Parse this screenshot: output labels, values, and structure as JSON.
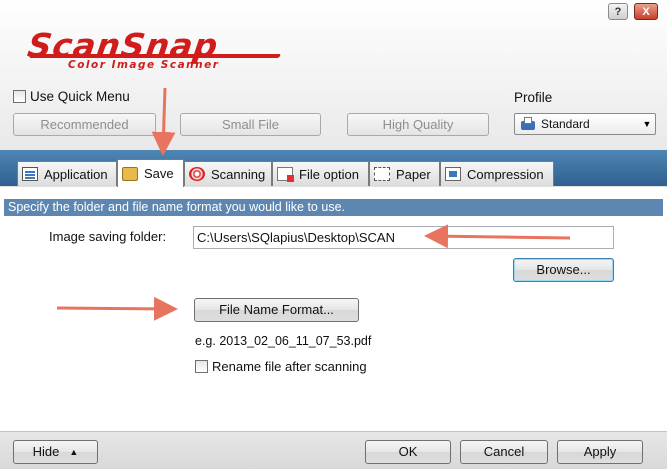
{
  "titlebar": {
    "help_label": "?",
    "close_label": "X"
  },
  "logo": {
    "main": "ScanSnap",
    "sub": "Color Image Scanner"
  },
  "quick_menu": {
    "label": "Use Quick Menu",
    "checked": false
  },
  "modes": {
    "recommended": "Recommended",
    "small_file": "Small File",
    "high_quality": "High Quality"
  },
  "profile": {
    "label": "Profile",
    "value": "Standard",
    "icon": "scanner-icon"
  },
  "tabs": [
    {
      "label": "Application",
      "icon": "application-icon"
    },
    {
      "label": "Save",
      "icon": "folder-icon",
      "active": true
    },
    {
      "label": "Scanning",
      "icon": "scanning-icon"
    },
    {
      "label": "File option",
      "icon": "file-option-icon"
    },
    {
      "label": "Paper",
      "icon": "paper-icon"
    },
    {
      "label": "Compression",
      "icon": "compression-icon"
    }
  ],
  "save_panel": {
    "description": "Specify the folder and file name format you would like to use.",
    "folder_label": "Image saving folder:",
    "folder_value": "C:\\Users\\SQlapius\\Desktop\\SCAN",
    "browse_label": "Browse...",
    "file_name_format_label": "File Name Format...",
    "example": "e.g. 2013_02_06_11_07_53.pdf",
    "rename_label": "Rename file after scanning",
    "rename_checked": false
  },
  "footer": {
    "hide_label": "Hide",
    "ok_label": "OK",
    "cancel_label": "Cancel",
    "apply_label": "Apply"
  },
  "colors": {
    "annotation_arrow": "#e8735f",
    "tab_strip": "#3b6c9c",
    "description_bar": "#5d87b0",
    "logo": "#d11c1c"
  }
}
